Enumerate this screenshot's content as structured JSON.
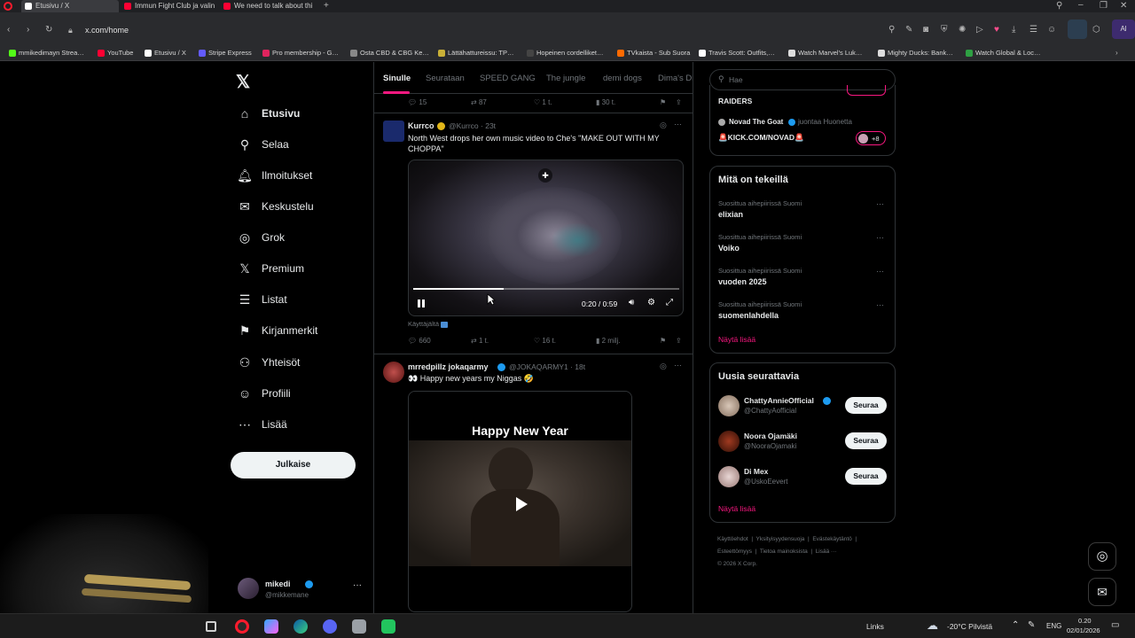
{
  "browser": {
    "tabs": [
      {
        "title": "Etusivu / X",
        "color": "#ffffff"
      },
      {
        "title": "Immun Fight Club ja valin",
        "color": "#ff0033"
      },
      {
        "title": "We need to talk about thi",
        "color": "#ff0033"
      }
    ],
    "url": "x.com/home",
    "bookmarks": [
      {
        "label": "mmikedimayn Strea…",
        "color": "#53fc18"
      },
      {
        "label": "YouTube",
        "color": "#ff0033"
      },
      {
        "label": "Etusivu / X",
        "color": "#ffffff"
      },
      {
        "label": "Stripe Express",
        "color": "#635bff"
      },
      {
        "label": "Pro membership - G…",
        "color": "#e0245e"
      },
      {
        "label": "Osta CBD & CBG Ke…",
        "color": "#888888"
      },
      {
        "label": "Lättähattureissu: TP…",
        "color": "#c9b037"
      },
      {
        "label": "Hopeinen cordelliket…",
        "color": "#444444"
      },
      {
        "label": "TVkaista - Sub Suora",
        "color": "#ff6a00"
      },
      {
        "label": "Travis Scott: Outfits,…",
        "color": "#ffffff"
      },
      {
        "label": "Watch Marvel's Luk…",
        "color": "#dddddd"
      },
      {
        "label": "Mighty Ducks: Bank…",
        "color": "#dddddd"
      },
      {
        "label": "Watch Global & Loc…",
        "color": "#2ea043"
      }
    ]
  },
  "nav": {
    "items": [
      {
        "label": "Etusivu",
        "icon": "home-icon",
        "glyph": "⌂"
      },
      {
        "label": "Selaa",
        "icon": "search-icon",
        "glyph": "⚲"
      },
      {
        "label": "Ilmoitukset",
        "icon": "bell-icon",
        "glyph": "🔔︎"
      },
      {
        "label": "Keskustelu",
        "icon": "mail-icon",
        "glyph": "✉"
      },
      {
        "label": "Grok",
        "icon": "grok-icon",
        "glyph": "◎"
      },
      {
        "label": "Premium",
        "icon": "x-icon",
        "glyph": "𝕏"
      },
      {
        "label": "Listat",
        "icon": "list-icon",
        "glyph": "☰"
      },
      {
        "label": "Kirjanmerkit",
        "icon": "bookmark-icon",
        "glyph": "⚑"
      },
      {
        "label": "Yhteisöt",
        "icon": "people-icon",
        "glyph": "⚇"
      },
      {
        "label": "Profiili",
        "icon": "person-icon",
        "glyph": "☺"
      },
      {
        "label": "Lisää",
        "icon": "more-icon",
        "glyph": "⋯"
      }
    ],
    "post_button": "Julkaise",
    "account": {
      "name": "mikedi",
      "handle": "@mikkemane"
    }
  },
  "feed": {
    "tabs": [
      "Sinulle",
      "Seurataan",
      "SPEED GANG",
      "The jungle",
      "demi dogs",
      "Dima's Di"
    ],
    "top_actions": {
      "replies": "15",
      "reposts": "87",
      "likes": "1 t.",
      "views": "30 t."
    },
    "post1": {
      "name": "Kurrco",
      "meta": "@Kurrco · 23t",
      "text": "North West drops her own music video to Che's \"MAKE OUT WITH MY CHOPPA\"",
      "video_time": "0:20 / 0:59",
      "video_progress": 0.34,
      "source": "Käyttäjältä",
      "replies": "660",
      "reposts": "1 t.",
      "likes": "16 t.",
      "views": "2 milj."
    },
    "post2": {
      "name": "mrredpillz jokaqarmy",
      "meta": "@JOKAQARMY1 · 18t",
      "text": "👀 Happy new years my Niggas 🤣",
      "media_caption": "Happy New Year"
    }
  },
  "right": {
    "search_placeholder": "Hae",
    "live": {
      "top_text": "RAIDERS",
      "host_line": "Novad The Goat",
      "host_suffix": "juontaa Huonetta",
      "title": "🚨KICK.COM/NOVAD🚨",
      "count": "+8"
    },
    "trends": {
      "title": "Mitä on tekeillä",
      "items": [
        {
          "meta": "Suosittua aihepiirissä Suomi",
          "name": "elixian"
        },
        {
          "meta": "Suosittua aihepiirissä Suomi",
          "name": "Voiko"
        },
        {
          "meta": "Suosittua aihepiirissä Suomi",
          "name": "vuoden 2025"
        },
        {
          "meta": "Suosittua aihepiirissä Suomi",
          "name": "suomenlahdella"
        }
      ],
      "show_more": "Näytä lisää"
    },
    "who_to_follow": {
      "title": "Uusia seurattavia",
      "items": [
        {
          "name": "ChattyAnnieOfficial",
          "handle": "@ChattyAofficial",
          "button": "Seuraa"
        },
        {
          "name": "Noora Ojamäki",
          "handle": "@NooraOjamaki",
          "button": "Seuraa"
        },
        {
          "name": "Di Mex",
          "handle": "@UskoEevert",
          "button": "Seuraa"
        }
      ],
      "show_more": "Näytä lisää"
    },
    "footer": {
      "row1": [
        "Käyttöehdot",
        "Yksityisyydensuoja",
        "Evästekäytäntö"
      ],
      "row2": [
        "Esteettömyys",
        "Tietoa mainoksista",
        "Lisää ···"
      ],
      "copyright": "© 2026 X Corp."
    }
  },
  "taskbar": {
    "links": "Links",
    "weather": "-20°C Pilvistä",
    "lang": "ENG",
    "time": "0.20",
    "date": "02/01/2026"
  },
  "colors": {
    "accent": "#f91880",
    "x_blue": "#1d9bf0",
    "bg": "#000000"
  }
}
